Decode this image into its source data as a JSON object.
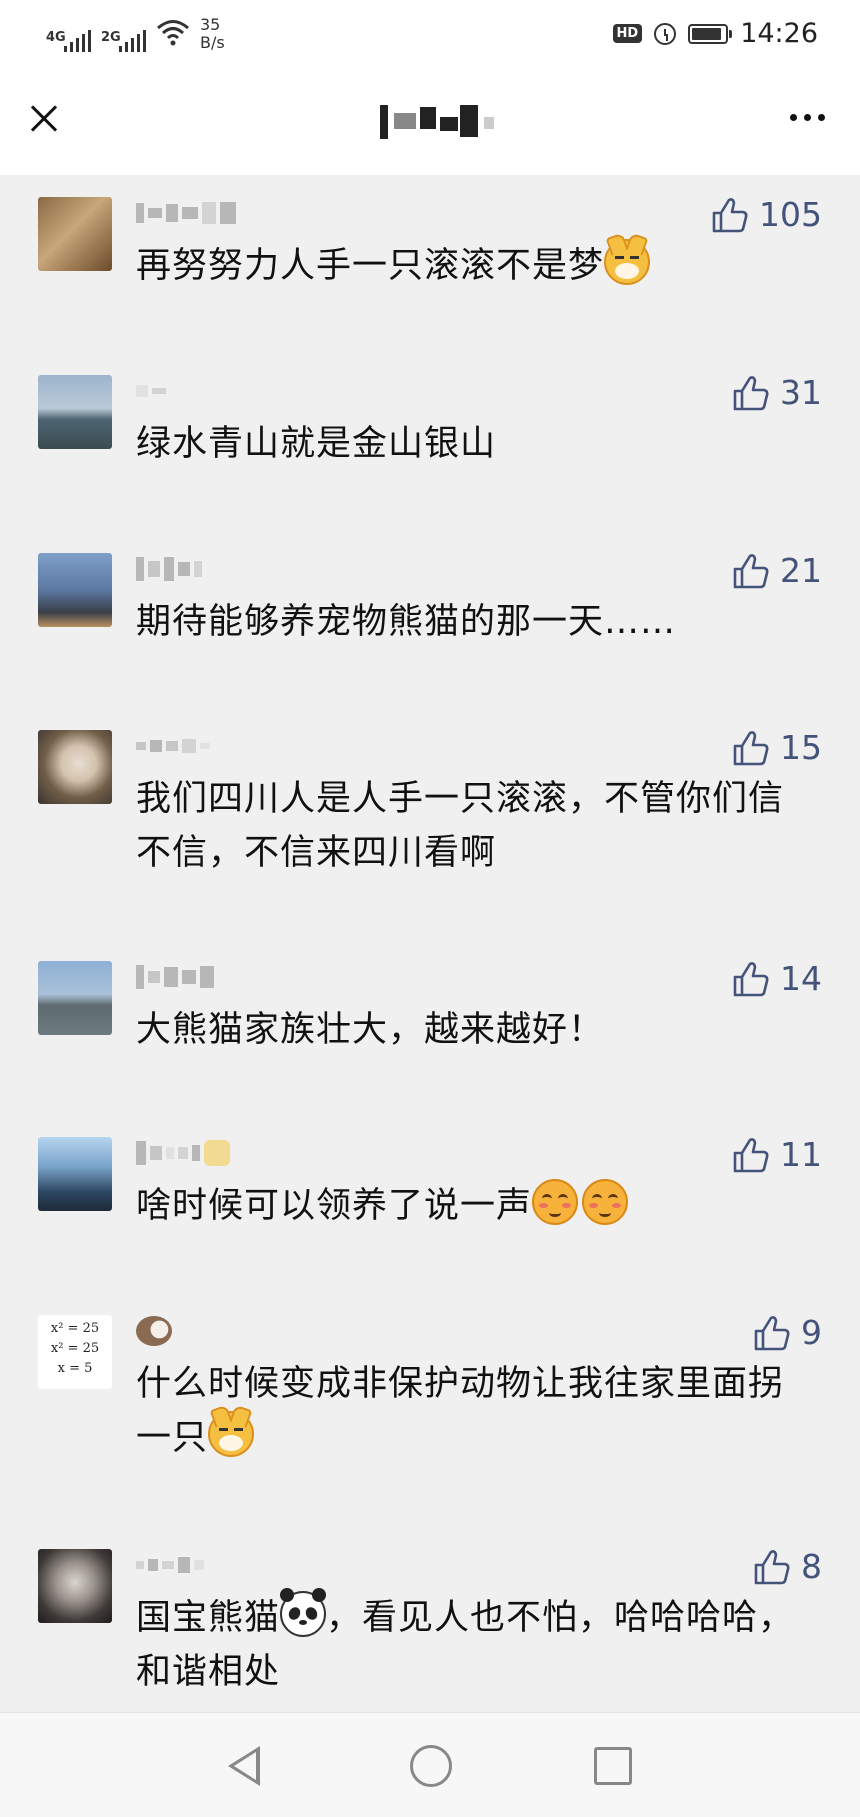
{
  "status_bar": {
    "net1": "4G",
    "net2": "2G",
    "speed_value": "35",
    "speed_unit": "B/s",
    "hd": "HD",
    "time": "14:26",
    "battery_level": 0.9
  },
  "comments": [
    {
      "likes": "105",
      "text": "再努努力人手一只滚滚不是梦",
      "emojis": [
        "dog-face"
      ]
    },
    {
      "likes": "31",
      "text": "绿水青山就是金山银山",
      "emojis": []
    },
    {
      "likes": "21",
      "text": "期待能够养宠物熊猫的那一天……",
      "emojis": []
    },
    {
      "likes": "15",
      "text": "我们四川人是人手一只滚滚，不管你们信不信，不信来四川看啊",
      "emojis": []
    },
    {
      "likes": "14",
      "text": "大熊猫家族壮大，越来越好！",
      "emojis": []
    },
    {
      "likes": "11",
      "text": "啥时候可以领养了说一声",
      "emojis": [
        "blush-face",
        "blush-face"
      ]
    },
    {
      "likes": "9",
      "text": "什么时候变成非保护动物让我往家里面拐一只",
      "emojis": [
        "dog-face"
      ],
      "avatar_text": [
        "x² = 25",
        "x² = 25",
        "x = 5"
      ]
    },
    {
      "likes": "8",
      "text_before": "国宝熊猫",
      "text_after": "，看见人也不怕，哈哈哈哈，和谐相处",
      "emojis": [
        "panda-face"
      ]
    }
  ],
  "icons": {
    "close": "close-icon",
    "more": "more-icon",
    "like": "thumbs-up-icon",
    "back": "back-triangle-icon",
    "home": "home-circle-icon",
    "recent": "recent-square-icon"
  },
  "colors": {
    "like": "#44537a",
    "background": "#f0f0f0"
  }
}
